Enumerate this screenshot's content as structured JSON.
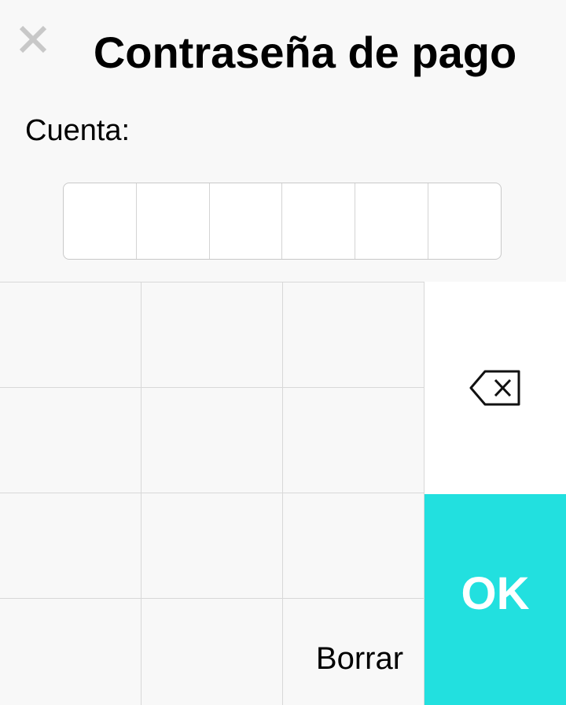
{
  "header": {
    "title": "Contraseña de pago",
    "close_icon": "close-icon"
  },
  "account": {
    "label": "Cuenta:"
  },
  "pin": {
    "length": 6,
    "digits": [
      "",
      "",
      "",
      "",
      "",
      ""
    ]
  },
  "keypad": {
    "keys": [
      "",
      "",
      "",
      "",
      "",
      "",
      "",
      "",
      "",
      "",
      "",
      "Borrar"
    ],
    "backspace_icon": "backspace-icon",
    "ok_label": "OK"
  },
  "colors": {
    "accent": "#22e0df",
    "background": "#f8f8f8",
    "close_icon": "#c8c8c8"
  }
}
